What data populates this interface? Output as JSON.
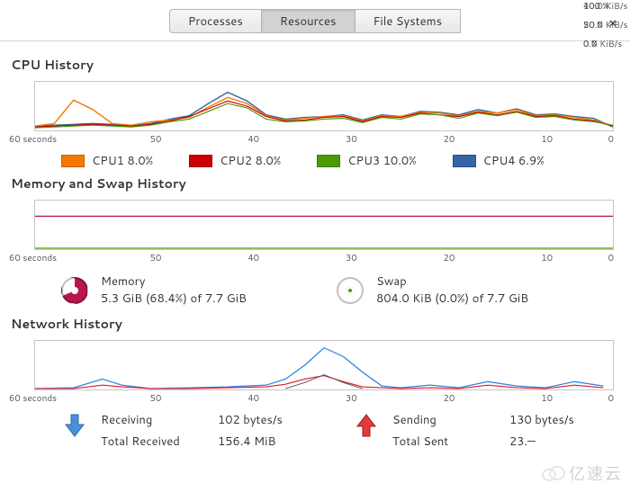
{
  "tabs": {
    "processes": "Processes",
    "resources": "Resources",
    "filesystems": "File Systems"
  },
  "sections": {
    "cpu": "CPU History",
    "mem": "Memory and Swap History",
    "net": "Network History"
  },
  "axis": {
    "x_left": "60 seconds",
    "x_50": "50",
    "x_40": "40",
    "x_30": "30",
    "x_20": "20",
    "x_10": "10",
    "x_0": "0",
    "y_cpu_100": "100 %",
    "y_cpu_50": "50 %",
    "y_cpu_0": "0 %",
    "y_mem_100": "100 %",
    "y_mem_50": "50 %",
    "y_mem_0": "0 %",
    "y_net_top": "40.0 KiB/s",
    "y_net_mid": "20.0 KiB/s",
    "y_net_0": "0.0 KiB/s"
  },
  "cpu": {
    "colors": {
      "cpu1": "#f57900",
      "cpu2": "#cc0000",
      "cpu3": "#4e9a06",
      "cpu4": "#3465a4"
    },
    "cpu1": "CPU1  8.0%",
    "cpu2": "CPU2  8.0%",
    "cpu3": "CPU3  10.0%",
    "cpu4": "CPU4  6.9%"
  },
  "memory": {
    "label": "Memory",
    "detail": "5.3 GiB (68.4%) of 7.7 GiB",
    "percent": 68.4,
    "color": "#b8174c"
  },
  "swap": {
    "label": "Swap",
    "detail": "804.0 KiB (0.0%) of 7.7 GiB",
    "percent": 0.0,
    "color": "#4e9a06"
  },
  "network": {
    "recv_color": "#3584e4",
    "send_color": "#e01b24",
    "recv_label": "Receiving",
    "recv_rate": "102 bytes/s",
    "recv_total_label": "Total Received",
    "recv_total": "156.4 MiB",
    "send_label": "Sending",
    "send_rate": "130 bytes/s",
    "send_total_label": "Total Sent",
    "send_total": "23.—"
  },
  "watermark": "亿速云",
  "chart_data": [
    {
      "type": "line",
      "title": "CPU History",
      "xlabel": "seconds",
      "ylabel": "%",
      "xlim": [
        60,
        0
      ],
      "ylim": [
        0,
        100
      ],
      "x": [
        60,
        58,
        56,
        54,
        52,
        50,
        48,
        46,
        44,
        42,
        40,
        38,
        36,
        34,
        32,
        30,
        28,
        26,
        24,
        22,
        20,
        18,
        16,
        14,
        12,
        10,
        8,
        6,
        4,
        2,
        0
      ],
      "series": [
        {
          "name": "CPU1",
          "color": "#f57900",
          "values": [
            8,
            15,
            62,
            42,
            14,
            10,
            18,
            22,
            26,
            48,
            68,
            55,
            30,
            22,
            25,
            28,
            30,
            20,
            30,
            28,
            38,
            35,
            30,
            40,
            35,
            42,
            30,
            32,
            26,
            22,
            8
          ]
        },
        {
          "name": "CPU2",
          "color": "#cc0000",
          "values": [
            6,
            8,
            10,
            12,
            10,
            8,
            12,
            20,
            28,
            45,
            60,
            50,
            28,
            20,
            22,
            26,
            28,
            18,
            28,
            26,
            36,
            33,
            28,
            38,
            32,
            40,
            28,
            30,
            24,
            20,
            8
          ]
        },
        {
          "name": "CPU3",
          "color": "#4e9a06",
          "values": [
            4,
            6,
            8,
            10,
            8,
            6,
            10,
            18,
            24,
            40,
            55,
            46,
            24,
            18,
            20,
            24,
            25,
            16,
            26,
            24,
            34,
            32,
            25,
            36,
            30,
            38,
            26,
            28,
            22,
            18,
            10
          ]
        },
        {
          "name": "CPU4",
          "color": "#3465a4",
          "values": [
            8,
            10,
            12,
            14,
            12,
            9,
            14,
            24,
            30,
            55,
            78,
            60,
            32,
            24,
            26,
            29,
            32,
            22,
            32,
            29,
            40,
            38,
            32,
            42,
            36,
            44,
            32,
            34,
            28,
            24,
            7
          ]
        }
      ]
    },
    {
      "type": "line",
      "title": "Memory and Swap History",
      "xlabel": "seconds",
      "ylabel": "%",
      "xlim": [
        60,
        0
      ],
      "ylim": [
        0,
        100
      ],
      "x": [
        60,
        50,
        40,
        30,
        20,
        10,
        0
      ],
      "series": [
        {
          "name": "Memory",
          "color": "#b8174c",
          "values": [
            68,
            68,
            68,
            68,
            68,
            68,
            68
          ]
        },
        {
          "name": "Swap",
          "color": "#4e9a06",
          "values": [
            0,
            0,
            0,
            0,
            0,
            0,
            0
          ]
        }
      ]
    },
    {
      "type": "line",
      "title": "Network History",
      "xlabel": "seconds",
      "ylabel": "KiB/s",
      "xlim": [
        60,
        0
      ],
      "ylim": [
        0,
        40
      ],
      "x": [
        60,
        55,
        50,
        48,
        45,
        40,
        35,
        32,
        30,
        28,
        26,
        24,
        22,
        20,
        18,
        15,
        12,
        10,
        8,
        5,
        2,
        0
      ],
      "series": [
        {
          "name": "Receiving",
          "color": "#3584e4",
          "values": [
            0,
            1,
            8,
            3,
            0,
            1,
            2,
            4,
            8,
            20,
            36,
            28,
            14,
            3,
            1,
            3,
            2,
            6,
            2,
            1,
            6,
            2
          ]
        },
        {
          "name": "Sending",
          "color": "#e01b24",
          "values": [
            0,
            0,
            3,
            1,
            0,
            0,
            1,
            2,
            4,
            10,
            12,
            6,
            2,
            1,
            0,
            1,
            1,
            3,
            1,
            0,
            3,
            1
          ]
        }
      ]
    }
  ]
}
